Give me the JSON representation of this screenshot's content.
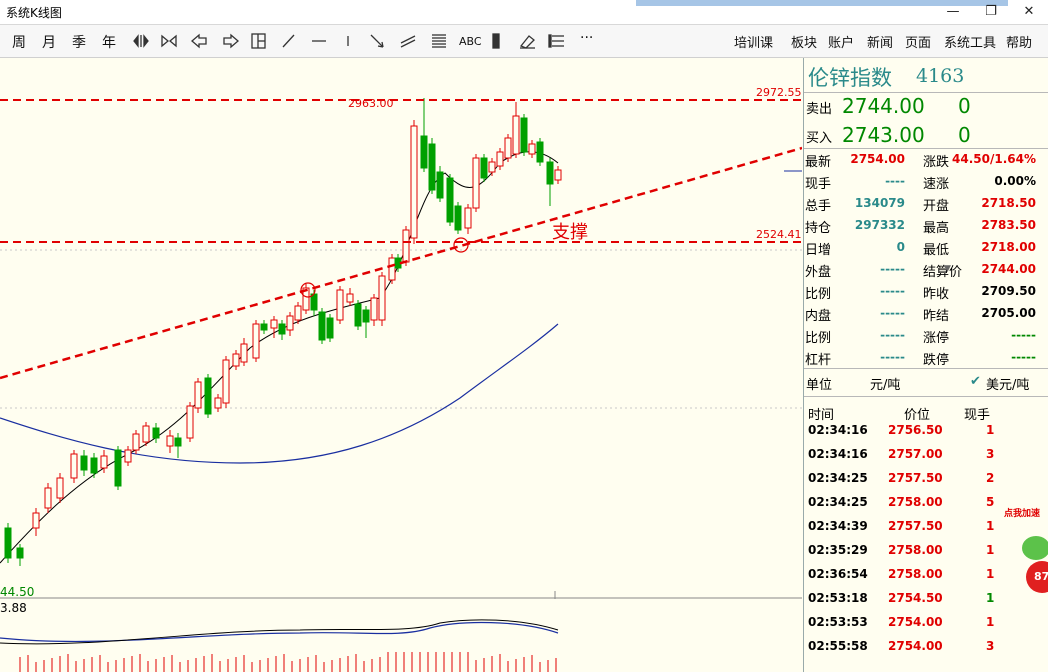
{
  "window": {
    "title": "系统K线图",
    "minimize": "—",
    "restore": "❐",
    "close": "✕"
  },
  "toolbar": {
    "left": [
      "周",
      "月",
      "季",
      "年"
    ],
    "icons": [
      "expand-horizontal-icon",
      "collapse-horizontal-icon",
      "arrow-left-icon",
      "arrow-right-icon",
      "layout-grid-icon",
      "diagonal-line-icon",
      "horizontal-line-icon",
      "vertical-line-icon",
      "arrow-line-icon",
      "parallel-lines-icon",
      "fibonacci-icon",
      "text-tool-icon",
      "bar-color-icon",
      "eraser-icon",
      "settings-list-icon",
      "more-icon"
    ],
    "abc": "ABC",
    "more": "···",
    "right": [
      "培训课",
      "板块",
      "账户",
      "新闻",
      "页面",
      "系统工具",
      "帮助"
    ]
  },
  "chart": {
    "top_price": "2963.00",
    "resistance_label": "2972.55",
    "support_label": "2524.41",
    "support_text": "支撑",
    "low_label": "44.50",
    "sub_label": "3.88"
  },
  "quote": {
    "name": "伦锌指数",
    "code": "4163",
    "sell_label": "卖出",
    "sell_price": "2744.00",
    "sell_qty": "0",
    "buy_label": "买入",
    "buy_price": "2743.00",
    "buy_qty": "0",
    "rows_left": [
      {
        "k": "最新",
        "v": "2754.00",
        "c": "red"
      },
      {
        "k": "现手",
        "v": "----",
        "c": "teal"
      },
      {
        "k": "总手",
        "v": "134079",
        "c": "teal"
      },
      {
        "k": "持仓",
        "v": "297332",
        "c": "teal"
      },
      {
        "k": "日增",
        "v": "0",
        "c": "teal"
      },
      {
        "k": "外盘",
        "v": "-----",
        "c": "teal"
      },
      {
        "k": "比例",
        "v": "-----",
        "c": "teal"
      },
      {
        "k": "内盘",
        "v": "-----",
        "c": "teal"
      },
      {
        "k": "比例",
        "v": "-----",
        "c": "teal"
      },
      {
        "k": "杠杆",
        "v": "-----",
        "c": "teal"
      }
    ],
    "rows_right": [
      {
        "k": "涨跌",
        "v": "44.50/1.64%",
        "c": "red"
      },
      {
        "k": "速涨",
        "v": "0.00%",
        "c": "black"
      },
      {
        "k": "开盘",
        "v": "2718.50",
        "c": "red"
      },
      {
        "k": "最高",
        "v": "2783.50",
        "c": "red"
      },
      {
        "k": "最低",
        "v": "2718.00",
        "c": "red"
      },
      {
        "k": "结算价",
        "v": "2744.00",
        "c": "red"
      },
      {
        "k": "昨收",
        "v": "2709.50",
        "c": "black"
      },
      {
        "k": "昨结",
        "v": "2705.00",
        "c": "black"
      },
      {
        "k": "涨停",
        "v": "-----",
        "c": "green"
      },
      {
        "k": "跌停",
        "v": "-----",
        "c": "green"
      }
    ],
    "unit_label": "单位",
    "unit_value": "元/吨",
    "unit_usd": "美元/吨"
  },
  "ticks": {
    "headers": [
      "时间",
      "价位",
      "现手"
    ],
    "rows": [
      {
        "t": "02:34:16",
        "p": "2756.50",
        "q": "1",
        "qc": "red"
      },
      {
        "t": "02:34:16",
        "p": "2757.00",
        "q": "3",
        "qc": "red"
      },
      {
        "t": "02:34:25",
        "p": "2757.50",
        "q": "2",
        "qc": "red"
      },
      {
        "t": "02:34:25",
        "p": "2758.00",
        "q": "5",
        "qc": "red"
      },
      {
        "t": "02:34:39",
        "p": "2757.50",
        "q": "1",
        "qc": "red"
      },
      {
        "t": "02:35:29",
        "p": "2758.00",
        "q": "1",
        "qc": "red"
      },
      {
        "t": "02:36:54",
        "p": "2758.00",
        "q": "1",
        "qc": "red"
      },
      {
        "t": "02:53:18",
        "p": "2754.50",
        "q": "1",
        "qc": "green"
      },
      {
        "t": "02:53:53",
        "p": "2754.00",
        "q": "1",
        "qc": "red"
      },
      {
        "t": "02:55:58",
        "p": "2754.00",
        "q": "3",
        "qc": "red"
      }
    ]
  },
  "speed_widget": {
    "label": "点我加速",
    "percent": "87"
  }
}
